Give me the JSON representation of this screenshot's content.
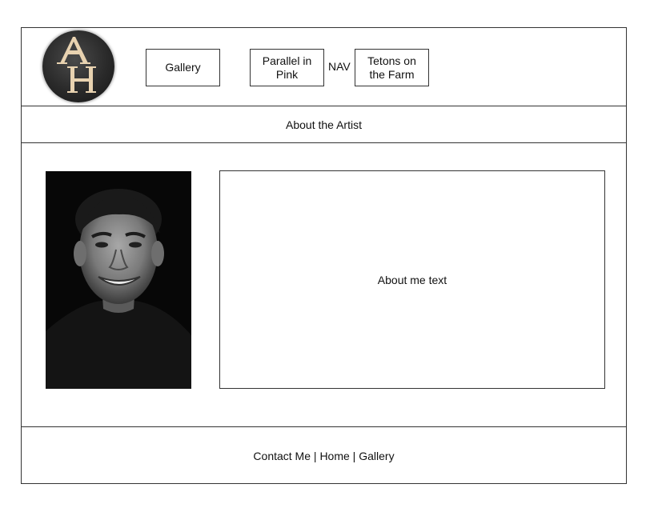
{
  "header": {
    "logo_text": "AH",
    "nav_label": "NAV",
    "nav_items": [
      {
        "label": "Gallery"
      },
      {
        "label": "Parallel in Pink"
      },
      {
        "label": "Tetons on the Farm"
      }
    ]
  },
  "subheader": {
    "title": "About the Artist"
  },
  "main": {
    "about_text": "About me text"
  },
  "footer": {
    "links": [
      "Contact Me",
      "Home",
      "Gallery"
    ],
    "separator": " | "
  },
  "colors": {
    "border": "#333333",
    "logo_bg": "#2a2a2a",
    "logo_letters": "#e8d2b0",
    "photo_bg": "#070707"
  }
}
